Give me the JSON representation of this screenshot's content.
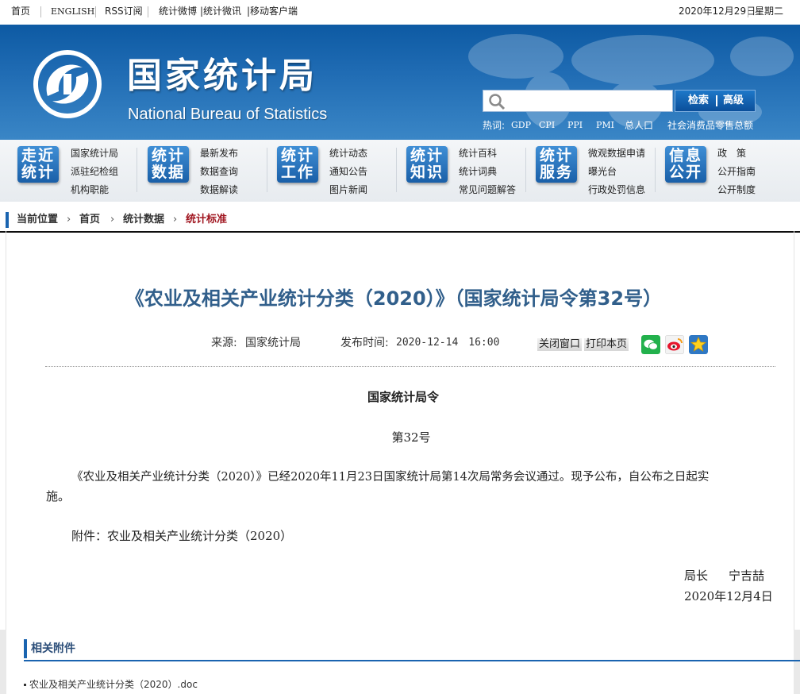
{
  "topbar": {
    "home": "首页",
    "english": "ENGLISH",
    "rss": "RSS订阅",
    "weibo": "统计微博",
    "weixin": "|统计微讯",
    "mobile": "|移动客户端",
    "date": "2020年12月29日",
    "weekday": "星期二"
  },
  "header": {
    "brand_cn": "国家统计局",
    "brand_en": "National Bureau of Statistics",
    "search_placeholder": "",
    "search_label": "检索",
    "advanced_label": "高级",
    "hot_label": "热词:",
    "hot_words": [
      "GDP",
      "CPI",
      "PPI",
      "PMI",
      "总人口",
      "社会消费品零售总额"
    ]
  },
  "nav": [
    {
      "icon_top": "走近",
      "icon_bottom": "统计",
      "links": [
        "国家统计局",
        "派驻纪检组",
        "机构职能"
      ]
    },
    {
      "icon_top": "统计",
      "icon_bottom": "数据",
      "links": [
        "最新发布",
        "数据查询",
        "数据解读"
      ]
    },
    {
      "icon_top": "统计",
      "icon_bottom": "工作",
      "links": [
        "统计动态",
        "通知公告",
        "图片新闻"
      ]
    },
    {
      "icon_top": "统计",
      "icon_bottom": "知识",
      "links": [
        "统计百科",
        "统计词典",
        "常见问题解答"
      ]
    },
    {
      "icon_top": "统计",
      "icon_bottom": "服务",
      "links": [
        "微观数据申请",
        "曝光台",
        "行政处罚信息"
      ]
    },
    {
      "icon_top": "信息",
      "icon_bottom": "公开",
      "links": [
        "政　策",
        "公开指南",
        "公开制度"
      ]
    }
  ],
  "breadcrumb": {
    "location": "当前位置",
    "items": [
      "首页",
      "统计数据",
      "统计标准"
    ]
  },
  "article": {
    "title": "《农业及相关产业统计分类（2020）》（国家统计局令第32号）",
    "source_label": "来源:",
    "source": "国家统计局",
    "published_label": "发布时间:",
    "published": "2020-12-14　16:00",
    "close_window": "关闭窗口",
    "print_page": "打印本页",
    "decree_title": "国家统计局令",
    "decree_number": "第32号",
    "body_line1": "《农业及相关产业统计分类（2020）》已经2020年11月23日国家统计局第14次局常务会议通过。现予公布，自公布之日起实",
    "body_line2": "施。",
    "attachment_line": "附件：农业及相关产业统计分类（2020）",
    "signer_title": "局长",
    "signer_name": "宁吉喆",
    "sign_date": "2020年12月4日"
  },
  "attachments": {
    "heading": "相关附件",
    "items": [
      "农业及相关产业统计分类（2020）.doc"
    ]
  }
}
